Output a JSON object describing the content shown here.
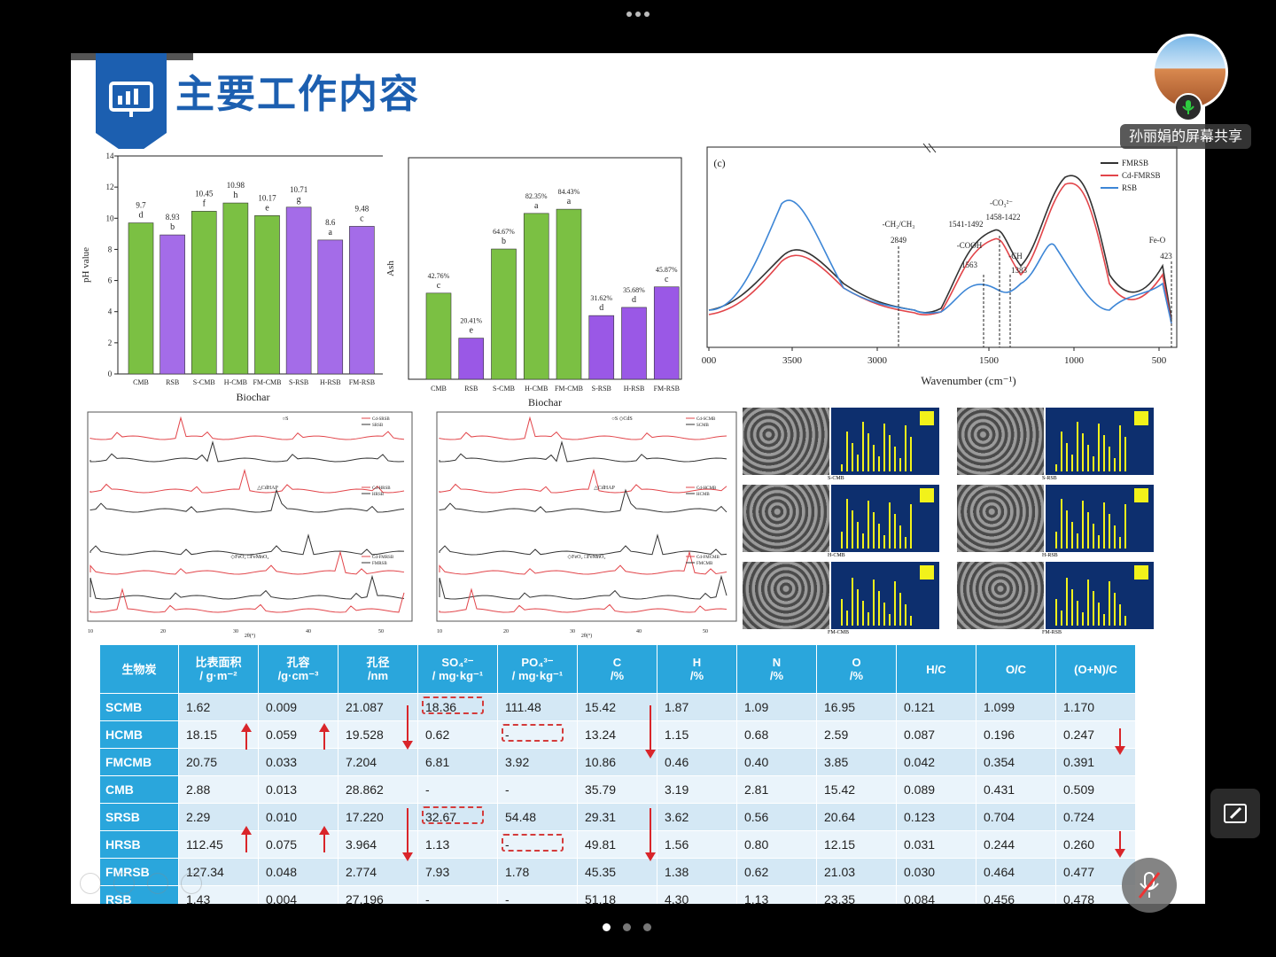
{
  "window": {
    "menu_icon": "more-dots-icon"
  },
  "slide": {
    "title": "主要工作内容",
    "icon": "presentation-chart-icon"
  },
  "meeting": {
    "share_label": "孙丽娟的屏幕共享",
    "mic_status": "on",
    "colors": {
      "mic": "#2ecc40",
      "accent": "#2aa6dc",
      "arrow": "#d9252a"
    }
  },
  "pager": {
    "pages": 3,
    "current": 1
  },
  "chart_data": [
    {
      "type": "bar",
      "categories": [
        "CMB",
        "RSB",
        "S-CMB",
        "H-CMB",
        "FM-CMB",
        "S-RSB",
        "H-RSB",
        "FM-RSB"
      ],
      "values": [
        9.7,
        8.93,
        10.45,
        10.98,
        10.17,
        10.71,
        8.6,
        9.48
      ],
      "bar_labels": [
        "9.7",
        "8.93",
        "10.45",
        "10.98",
        "10.17",
        "10.71",
        "8.6",
        "9.48"
      ],
      "letters": [
        "d",
        "b",
        "f",
        "h",
        "e",
        "g",
        "a",
        "c"
      ],
      "xlabel": "Biochar",
      "ylabel": "pH value",
      "ylim": [
        0,
        14
      ],
      "yticks": [
        "0",
        "2",
        "4",
        "6",
        "8",
        "10",
        "12",
        "14"
      ],
      "colors": {
        "green": "#7bc043",
        "purple": "#a46ce8"
      }
    },
    {
      "type": "bar",
      "categories": [
        "CMB",
        "RSB",
        "S-CMB",
        "H-CMB",
        "FM-CMB",
        "S-RSB",
        "H-RSB",
        "FM-RSB"
      ],
      "values": [
        42.76,
        20.41,
        64.67,
        82.35,
        84.43,
        31.62,
        35.68,
        45.87
      ],
      "bar_labels": [
        "42.76%",
        "20.41%",
        "64.67%",
        "82.35%",
        "84.43%",
        "31.62%",
        "35.68%",
        "45.87%"
      ],
      "letters": [
        "c",
        "e",
        "b",
        "a",
        "a",
        "d",
        "d",
        "c"
      ],
      "xlabel": "Biochar",
      "ylabel": "Ash"
    },
    {
      "type": "line",
      "panel_label": "(c)",
      "series": [
        {
          "name": "FMRSB",
          "color": "#333333"
        },
        {
          "name": "Cd-FMRSB",
          "color": "#e2454a"
        },
        {
          "name": "RSB",
          "color": "#3d86d6"
        }
      ],
      "xlabel": "Wavenumber (cm⁻¹)",
      "xticks": [
        "000",
        "3500",
        "3000",
        "1500",
        "1000",
        "500"
      ],
      "annotations": [
        "-CH₂/CH₃",
        "2849",
        "-COOH",
        "1541-1492",
        "-CO₃²⁻",
        "1458-1422",
        "-CH",
        "1563",
        "1383",
        "Fe-O",
        "423"
      ]
    }
  ],
  "xrd": {
    "left": {
      "legends": [
        [
          "Cd-SRSB",
          "SRSB"
        ],
        [
          "Cd-HRSB",
          "HRSB"
        ],
        [
          "Cd-FMRSB",
          "FMRSB"
        ]
      ],
      "markers": [
        "○S",
        "△CdHAP",
        "◇FeO₂ □FeMnO₂"
      ],
      "xticks": [
        "10",
        "20",
        "30",
        "40",
        "50"
      ],
      "xlabel": "2θ(°)"
    },
    "right": {
      "legends": [
        [
          "Cd-SCMB",
          "SCMB"
        ],
        [
          "Cd-HCMB",
          "HCMB"
        ],
        [
          "Cd-FMCMB",
          "FMCMB"
        ]
      ],
      "markers": [
        "○S ◇CdS",
        "△CdHAP",
        "◇FeO₂ □FeMnO₂"
      ],
      "xticks": [
        "10",
        "20",
        "30",
        "40",
        "50"
      ],
      "xlabel": "2θ(°)"
    }
  },
  "sem_labels": [
    "S-CMB",
    "H-CMB",
    "FM-CMB",
    "S-RSB",
    "H-RSB",
    "FM-RSB"
  ],
  "table": {
    "headers": [
      [
        "生物炭"
      ],
      [
        "比表面积",
        "/ g·m⁻²"
      ],
      [
        "孔容",
        "/g·cm⁻³"
      ],
      [
        "孔径",
        "/nm"
      ],
      [
        "SO₄²⁻",
        "/ mg·kg⁻¹"
      ],
      [
        "PO₄³⁻",
        "/ mg·kg⁻¹"
      ],
      [
        "C",
        "/%"
      ],
      [
        "H",
        "/%"
      ],
      [
        "N",
        "/%"
      ],
      [
        "O",
        "/%"
      ],
      [
        "H/C"
      ],
      [
        "O/C"
      ],
      [
        "(O+N)/C"
      ]
    ],
    "rows": [
      [
        "SCMB",
        "1.62",
        "0.009",
        "21.087",
        "18.36",
        "111.48",
        "15.42",
        "1.87",
        "1.09",
        "16.95",
        "0.121",
        "1.099",
        "1.170"
      ],
      [
        "HCMB",
        "18.15",
        "0.059",
        "19.528",
        "0.62",
        "-",
        "13.24",
        "1.15",
        "0.68",
        "2.59",
        "0.087",
        "0.196",
        "0.247"
      ],
      [
        "FMCMB",
        "20.75",
        "0.033",
        "7.204",
        "6.81",
        "3.92",
        "10.86",
        "0.46",
        "0.40",
        "3.85",
        "0.042",
        "0.354",
        "0.391"
      ],
      [
        "CMB",
        "2.88",
        "0.013",
        "28.862",
        "-",
        "-",
        "35.79",
        "3.19",
        "2.81",
        "15.42",
        "0.089",
        "0.431",
        "0.509"
      ],
      [
        "SRSB",
        "2.29",
        "0.010",
        "17.220",
        "32.67",
        "54.48",
        "29.31",
        "3.62",
        "0.56",
        "20.64",
        "0.123",
        "0.704",
        "0.724"
      ],
      [
        "HRSB",
        "112.45",
        "0.075",
        "3.964",
        "1.13",
        "-",
        "49.81",
        "1.56",
        "0.80",
        "12.15",
        "0.031",
        "0.244",
        "0.260"
      ],
      [
        "FMRSB",
        "127.34",
        "0.048",
        "2.774",
        "7.93",
        "1.78",
        "45.35",
        "1.38",
        "0.62",
        "21.03",
        "0.030",
        "0.464",
        "0.477"
      ],
      [
        "RSB",
        "1.43",
        "0.004",
        "27.196",
        "-",
        "-",
        "51.18",
        "4.30",
        "1.13",
        "23.35",
        "0.084",
        "0.456",
        "0.478"
      ]
    ]
  },
  "controls": {
    "annotate_icon": "edit-screen-icon",
    "mute_icon": "mic-muted-icon"
  }
}
